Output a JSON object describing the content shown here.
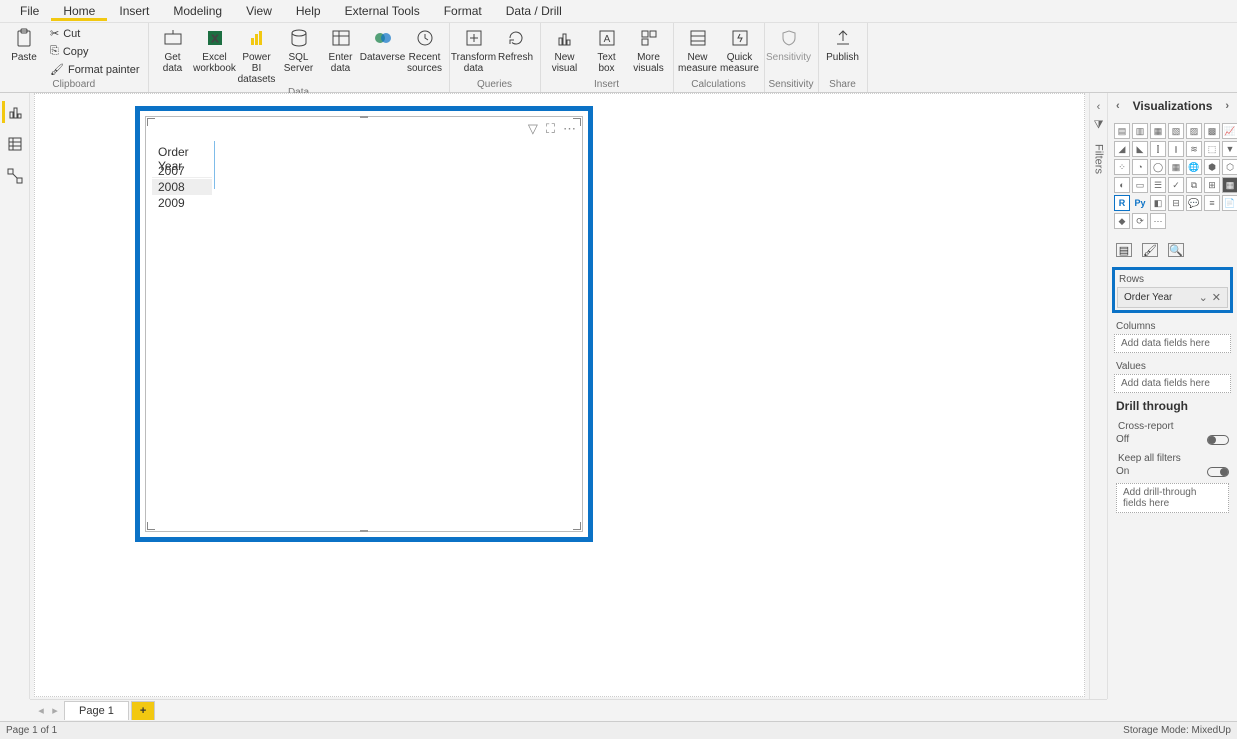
{
  "menu": {
    "items": [
      "File",
      "Home",
      "Insert",
      "Modeling",
      "View",
      "Help",
      "External Tools",
      "Format",
      "Data / Drill"
    ],
    "active_index": 1
  },
  "ribbon": {
    "groups": {
      "clipboard": {
        "label": "Clipboard",
        "paste": "Paste",
        "cut": "Cut",
        "copy": "Copy",
        "format_painter": "Format painter"
      },
      "data": {
        "label": "Data",
        "get_data": "Get data",
        "excel": "Excel workbook",
        "pbi": "Power BI datasets",
        "sql": "SQL Server",
        "enter": "Enter data",
        "dataverse": "Dataverse",
        "recent": "Recent sources"
      },
      "queries": {
        "label": "Queries",
        "transform": "Transform data",
        "refresh": "Refresh"
      },
      "insert": {
        "label": "Insert",
        "new_visual": "New visual",
        "text_box": "Text box",
        "more_visuals": "More visuals"
      },
      "calc": {
        "label": "Calculations",
        "new_measure": "New measure",
        "quick_measure": "Quick measure"
      },
      "sensitivity": {
        "label": "Sensitivity",
        "sensitivity": "Sensitivity"
      },
      "share": {
        "label": "Share",
        "publish": "Publish"
      }
    }
  },
  "left_rails": {
    "report": "Report",
    "data": "Data",
    "model": "Model"
  },
  "filters_panel": {
    "title": "Filters"
  },
  "visual": {
    "header": "Order Year",
    "rows": [
      "2007",
      "2008",
      "2009"
    ]
  },
  "viz_panel": {
    "title": "Visualizations",
    "rows_label": "Rows",
    "rows_field": "Order Year",
    "columns_label": "Columns",
    "columns_placeholder": "Add data fields here",
    "values_label": "Values",
    "values_placeholder": "Add data fields here",
    "drill_title": "Drill through",
    "cross_report_label": "Cross-report",
    "cross_report_value": "Off",
    "keep_filters_label": "Keep all filters",
    "keep_filters_value": "On",
    "drill_placeholder": "Add drill-through fields here"
  },
  "page_tabs": {
    "page1": "Page 1",
    "add": "+"
  },
  "status_bar": {
    "left": "Page 1 of 1",
    "right": "Storage Mode: MixedUp"
  }
}
